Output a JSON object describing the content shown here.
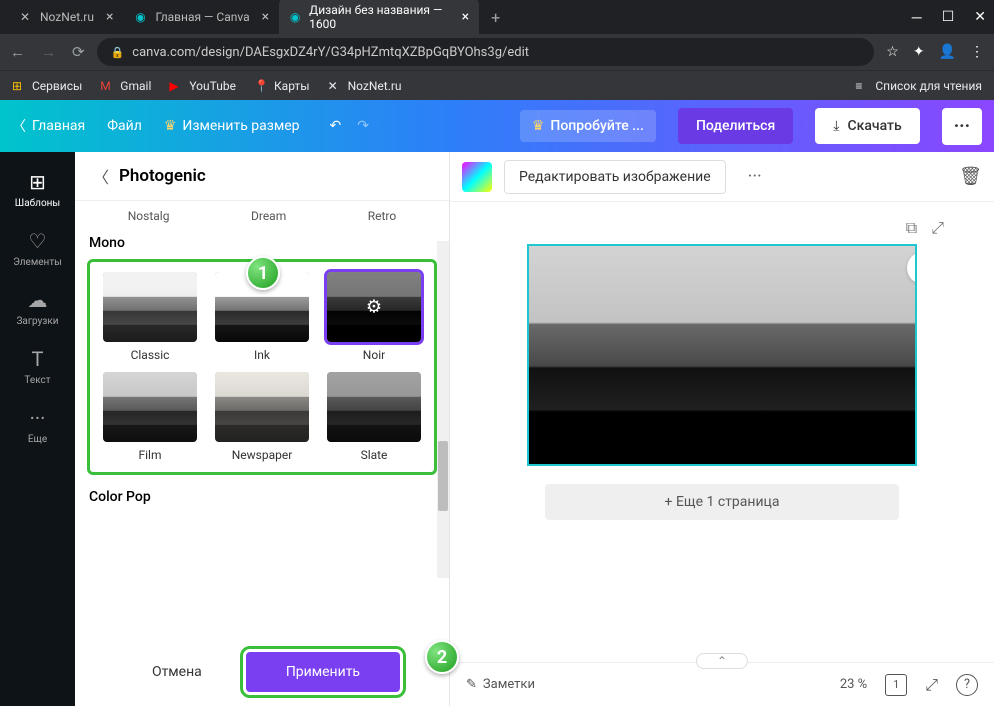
{
  "browser": {
    "tabs": [
      {
        "icon": "noznet",
        "title": "NozNet.ru"
      },
      {
        "icon": "canva",
        "title": "Главная — Canva"
      },
      {
        "icon": "canva",
        "title": "Дизайн без названия — 1600"
      }
    ],
    "new_tab": "+",
    "url": "canva.com/design/DAEsgxDZ4rY/G34pHZmtqXZBpGqBYOhs3g/edit",
    "bookmarks": {
      "services": "Сервисы",
      "gmail": "Gmail",
      "youtube": "YouTube",
      "maps": "Карты",
      "noznet": "NozNet.ru",
      "reading_list": "Список для чтения"
    }
  },
  "topbar": {
    "home": "Главная",
    "file": "Файл",
    "resize": "Изменить размер",
    "try": "Попробуйте ...",
    "share": "Поделиться",
    "download": "Скачать"
  },
  "rail": {
    "templates": "Шаблоны",
    "elements": "Элементы",
    "uploads": "Загрузки",
    "text": "Текст",
    "more": "Еще"
  },
  "panel": {
    "title": "Photogenic",
    "prev_row": [
      "Nostalg",
      "Dream",
      "Retro"
    ],
    "section": "Mono",
    "filters": [
      "Classic",
      "Ink",
      "Noir",
      "Film",
      "Newspaper",
      "Slate"
    ],
    "next_section": "Color Pop",
    "cancel": "Отмена",
    "apply": "Применить"
  },
  "canvas": {
    "edit_image": "Редактировать изображение",
    "add_page": "+ Еще 1 страница",
    "notes": "Заметки",
    "zoom": "23 %",
    "page_count": "1"
  },
  "annotations": {
    "one": "1",
    "two": "2"
  }
}
